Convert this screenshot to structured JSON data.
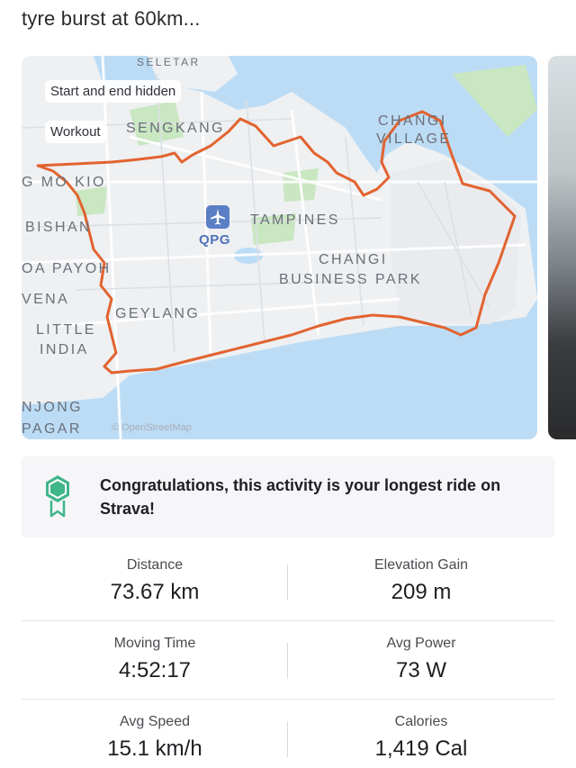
{
  "post": {
    "caption": "tyre burst at 60km..."
  },
  "map": {
    "tags": {
      "hidden": "Start and end hidden",
      "workout": "Workout"
    },
    "labels": {
      "sengkang": "SENGKANG",
      "changi_village_1": "CHANGI",
      "changi_village_2": "VILLAGE",
      "ang_mo_kio": "G MO KIO",
      "bishan": "BISHAN",
      "toa_payoh": "OA PAYOH",
      "tampines": "TAMPINES",
      "changi_bp_1": "CHANGI",
      "changi_bp_2": "BUSINESS PARK",
      "vena": "VENA",
      "geylang": "GEYLANG",
      "little_india_1": "LITTLE",
      "little_india_2": "INDIA",
      "njong": "NJONG",
      "pagar": "PAGAR",
      "seletar": "SELETAR",
      "qpg": "QPG"
    },
    "attribution": "© OpenStreetMap",
    "route_color": "#e2632f",
    "water_color": "#bcdcf5",
    "park_color": "#c9e7c1"
  },
  "achievement": {
    "text": "Congratulations, this activity is your longest ride on Strava!",
    "icon": "trophy-badge-icon",
    "icon_color": "#3fb58a"
  },
  "stats": {
    "distance": {
      "label": "Distance",
      "value": "73.67 km"
    },
    "elevation": {
      "label": "Elevation Gain",
      "value": "209 m"
    },
    "moving_time": {
      "label": "Moving Time",
      "value": "4:52:17"
    },
    "avg_power": {
      "label": "Avg Power",
      "value": "73 W"
    },
    "avg_speed": {
      "label": "Avg Speed",
      "value": "15.1 km/h"
    },
    "calories": {
      "label": "Calories",
      "value": "1,419 Cal"
    }
  }
}
